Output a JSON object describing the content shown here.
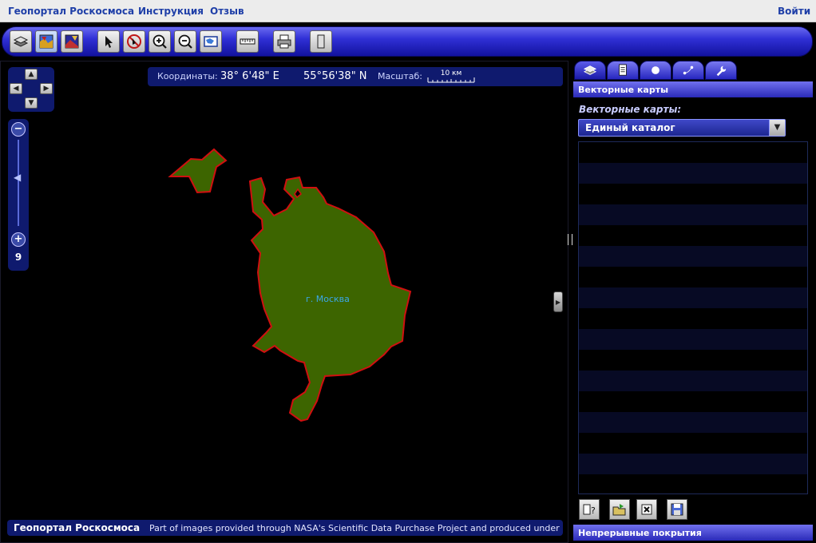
{
  "topnav": {
    "site_link": "Геопортал Роскосмоса",
    "help_link": "Инструкция",
    "feedback_link": "Отзыв",
    "login_link": "Войти"
  },
  "toolbar": {
    "buttons": [
      "layers-icon",
      "map-color-icon",
      "map-image-icon",
      "pointer-icon",
      "no-pan-icon",
      "zoom-in-icon",
      "zoom-out-icon",
      "full-extent-icon",
      "ruler-icon",
      "print-icon",
      "panel-toggle-icon"
    ],
    "active": "map-color-icon"
  },
  "map": {
    "coord_label": "Координаты:",
    "longitude": "38° 6'48\" E",
    "latitude": "55°56'38\" N",
    "scale_label": "Масштаб:",
    "scale_value": "10 км",
    "zoom_level": "9",
    "feature_label": "г. Москва",
    "feature_fill": "#3d6500",
    "feature_stroke": "#d01010",
    "attribution_brand": "Геопортал Роскосмоса",
    "attribution_text": "Part of images provided through NASA's Scientific Data Purchase Project and produced under NASA's Earth Science Data Systems program."
  },
  "panel": {
    "tabs": [
      "layers-tab-icon",
      "document-tab-icon",
      "circle-tab-icon",
      "route-tab-icon",
      "wrench-tab-icon"
    ],
    "header": "Векторные карты",
    "vector_label": "Векторные карты:",
    "catalog_selected": "Единый каталог",
    "footer_header": "Непрерывные покрытия",
    "actions": [
      "help-book-icon",
      "open-folder-icon",
      "delete-icon",
      "save-icon"
    ]
  },
  "colors": {
    "accent": "#2a2ad0",
    "panel_dark": "#0f1a6e",
    "link": "#1f3fa8"
  }
}
